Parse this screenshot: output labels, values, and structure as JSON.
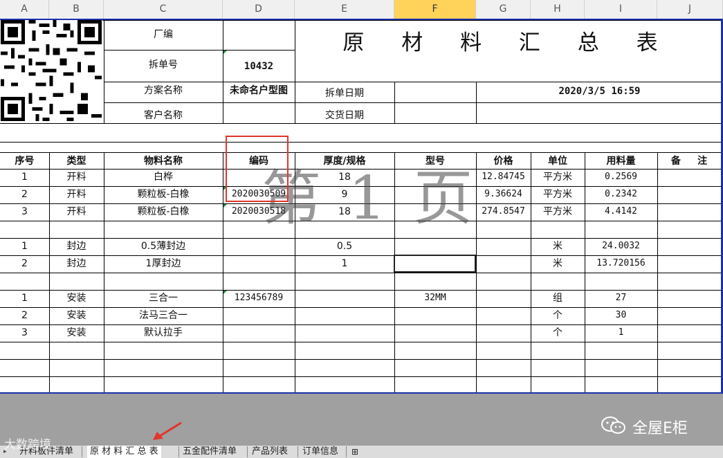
{
  "columns": [
    "A",
    "B",
    "C",
    "D",
    "E",
    "F",
    "G",
    "H",
    "I",
    "J"
  ],
  "selected_column": "F",
  "header": {
    "title": "原 材 料 汇 总 表",
    "factory_no_label": "厂编",
    "order_no_label": "拆单号",
    "order_no_value": "10432",
    "plan_name_label": "方案名称",
    "plan_name_value": "未命名户型图",
    "split_date_label": "拆单日期",
    "split_date_value": "2020/3/5  16:59",
    "customer_label": "客户名称",
    "delivery_date_label": "交货日期"
  },
  "table_headers": {
    "seq": "序号",
    "type": "类型",
    "material": "物料名称",
    "code": "编码",
    "thickness": "厚度/规格",
    "model": "型号",
    "price": "价格",
    "unit": "单位",
    "quantity": "用料量",
    "note": "备     注"
  },
  "rows": [
    {
      "seq": "1",
      "type": "开料",
      "material": "白桦",
      "code": "",
      "thickness": "18",
      "model": "",
      "price": "12.84745",
      "unit": "平方米",
      "quantity": "0.2569"
    },
    {
      "seq": "2",
      "type": "开料",
      "material": "颗粒板-白橡",
      "code": "2020030509",
      "thickness": "9",
      "model": "",
      "price": "9.36624",
      "unit": "平方米",
      "quantity": "0.2342"
    },
    {
      "seq": "3",
      "type": "开料",
      "material": "颗粒板-白橡",
      "code": "2020030518",
      "thickness": "18",
      "model": "",
      "price": "274.8547",
      "unit": "平方米",
      "quantity": "4.4142"
    },
    {
      "seq": "1",
      "type": "封边",
      "material": "0.5薄封边",
      "code": "",
      "thickness": "0.5",
      "model": "",
      "price": "",
      "unit": "米",
      "quantity": "24.0032"
    },
    {
      "seq": "2",
      "type": "封边",
      "material": "1厚封边",
      "code": "",
      "thickness": "1",
      "model": "",
      "price": "",
      "unit": "米",
      "quantity": "13.720156"
    },
    {
      "seq": "1",
      "type": "安装",
      "material": "三合一",
      "code": "123456789",
      "thickness": "",
      "model": "32MM",
      "price": "",
      "unit": "组",
      "quantity": "27"
    },
    {
      "seq": "2",
      "type": "安装",
      "material": "法马三合一",
      "code": "",
      "thickness": "",
      "model": "",
      "price": "",
      "unit": "个",
      "quantity": "30"
    },
    {
      "seq": "3",
      "type": "安装",
      "material": "默认拉手",
      "code": "",
      "thickness": "",
      "model": "",
      "price": "",
      "unit": "个",
      "quantity": "1"
    }
  ],
  "page_watermark": "第 1 页",
  "tabs": [
    "开料板件清单",
    "原 材 料 汇 总 表",
    "五金配件清单",
    "产品列表",
    "订单信息"
  ],
  "active_tab": "原 材 料 汇 总 表",
  "brand_watermark": "全屋E柜",
  "corner_watermark": "大数跨境",
  "colors": {
    "accent_border": "#1a2fa8",
    "highlight_box": "#e0362a",
    "selected_col": "#ffd25a"
  }
}
